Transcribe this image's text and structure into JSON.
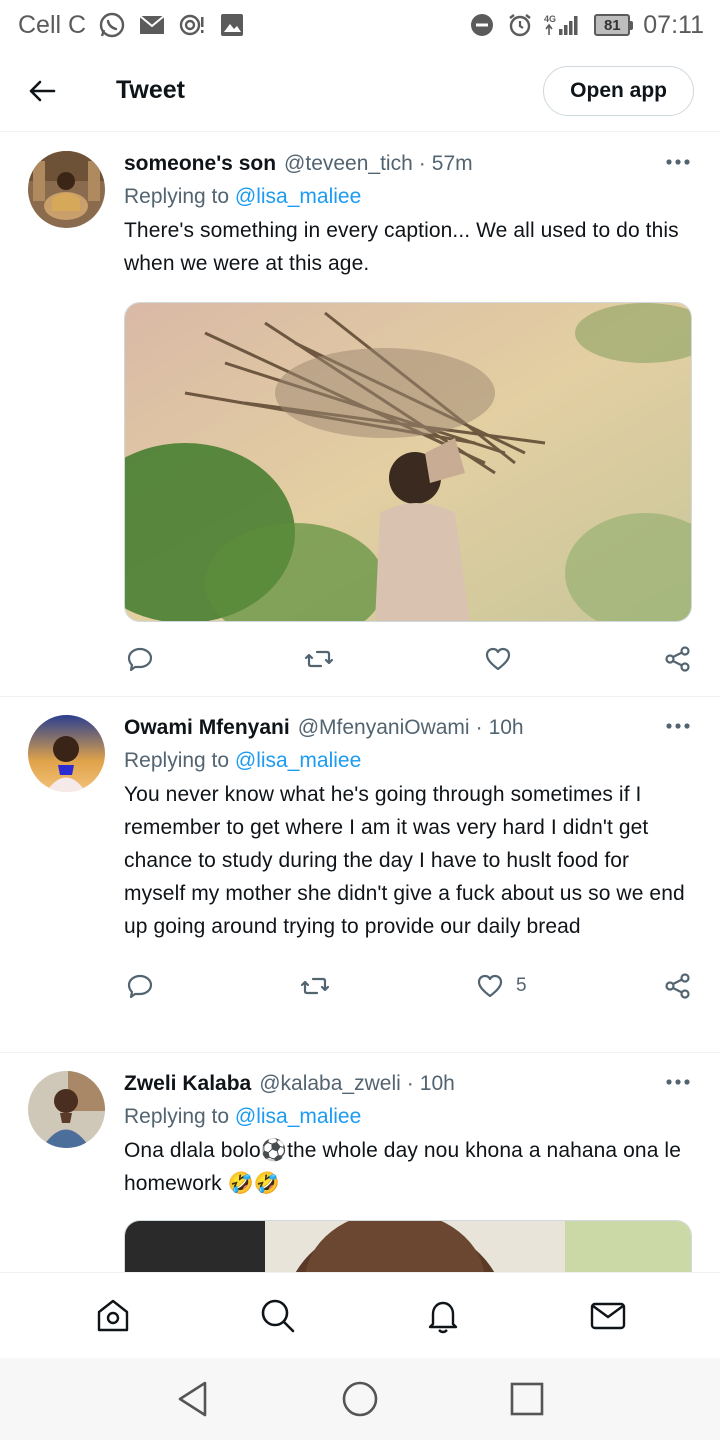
{
  "status_bar": {
    "carrier": "Cell C",
    "network": "4G",
    "battery": "81",
    "time": "07:11",
    "left_icons": [
      "whatsapp-icon",
      "mail-icon",
      "hotspot-icon",
      "image-icon"
    ],
    "right_icons": [
      "do-not-disturb-icon",
      "alarm-icon",
      "signal-icon",
      "battery-icon"
    ]
  },
  "header": {
    "title": "Tweet",
    "open_app_label": "Open app"
  },
  "tweets": [
    {
      "name": "someone's son",
      "handle": "@teveen_tich",
      "separator": "·",
      "time": "57m",
      "replying_label": "Replying to",
      "replying_to": "@lisa_maliee",
      "text": "There's something in every caption... We all used to do this when we were at this age.",
      "has_media": true,
      "likes": ""
    },
    {
      "name": "Owami Mfenyani",
      "handle": "@MfenyaniOwami",
      "separator": "·",
      "time": "10h",
      "replying_label": "Replying to",
      "replying_to": "@lisa_maliee",
      "text": "You never know what he's going through sometimes if I remember to get where I am it was very hard I didn't get chance to study during the day I have to huslt food for myself my mother she didn't give a fuck about us so we end up going around trying to provide our daily bread",
      "has_media": false,
      "likes": "5"
    },
    {
      "name": "Zweli Kalaba",
      "handle": "@kalaba_zweli",
      "separator": "·",
      "time": "10h",
      "replying_label": "Replying to",
      "replying_to": "@lisa_maliee",
      "text": "Ona dlala bolo⚽the whole day nou khona a nahana ona le homework 🤣🤣",
      "has_media": true,
      "likes": ""
    }
  ],
  "bottom_nav": [
    "home-icon",
    "search-icon",
    "notifications-icon",
    "messages-icon"
  ],
  "system_nav": [
    "back-triangle-icon",
    "home-circle-icon",
    "recents-square-icon"
  ],
  "colors": {
    "accent": "#1d9bf0",
    "text": "#0f1419",
    "secondary": "#536471",
    "divider": "#eff3f4"
  }
}
